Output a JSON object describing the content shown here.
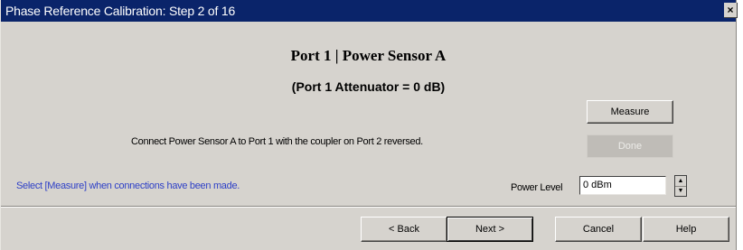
{
  "window": {
    "title": "Phase Reference Calibration: Step 2 of 16",
    "close_glyph": "×"
  },
  "content": {
    "heading": "Port 1 | Power Sensor A",
    "subheading": "(Port 1 Attenuator = 0 dB)",
    "instruction": "Connect Power Sensor A to Port 1 with the coupler on Port 2 reversed.",
    "hint": "Select [Measure] when connections have been made."
  },
  "buttons": {
    "measure": "Measure",
    "done": "Done",
    "back": "< Back",
    "next": "Next >",
    "cancel": "Cancel",
    "help": "Help"
  },
  "power": {
    "label": "Power Level",
    "value": "0 dBm",
    "up_glyph": "▲",
    "down_glyph": "▼"
  },
  "colors": {
    "title_bar": "#0a246a",
    "dialog_bg": "#d6d3ce",
    "hint_text": "#2d3fc7"
  }
}
